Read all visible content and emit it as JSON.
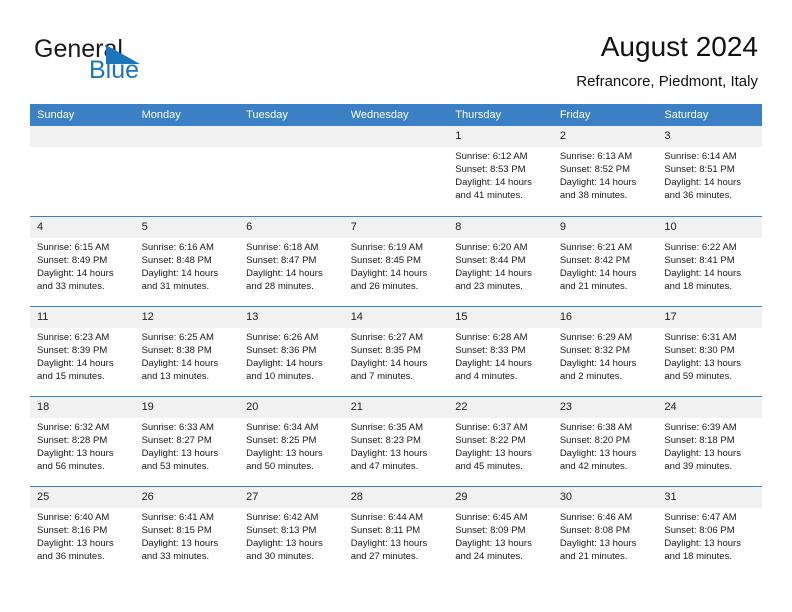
{
  "brand": {
    "name_part1": "General",
    "name_part2": "Blue",
    "logo_icon": "triangle-flag-icon",
    "accent_color": "#1b75bb"
  },
  "header": {
    "title": "August 2024",
    "subtitle": "Refrancore, Piedmont, Italy"
  },
  "theme": {
    "header_blue": "#3b7fc4",
    "daynum_background": "#f1f1f1",
    "text_color": "#1a1a1a"
  },
  "weekdays": [
    "Sunday",
    "Monday",
    "Tuesday",
    "Wednesday",
    "Thursday",
    "Friday",
    "Saturday"
  ],
  "weeks": [
    [
      {
        "day": "",
        "sunrise": "",
        "sunset": "",
        "daylight_line1": "",
        "daylight_line2": "",
        "empty": true
      },
      {
        "day": "",
        "sunrise": "",
        "sunset": "",
        "daylight_line1": "",
        "daylight_line2": "",
        "empty": true
      },
      {
        "day": "",
        "sunrise": "",
        "sunset": "",
        "daylight_line1": "",
        "daylight_line2": "",
        "empty": true
      },
      {
        "day": "",
        "sunrise": "",
        "sunset": "",
        "daylight_line1": "",
        "daylight_line2": "",
        "empty": true
      },
      {
        "day": "1",
        "sunrise": "Sunrise: 6:12 AM",
        "sunset": "Sunset: 8:53 PM",
        "daylight_line1": "Daylight: 14 hours",
        "daylight_line2": "and 41 minutes."
      },
      {
        "day": "2",
        "sunrise": "Sunrise: 6:13 AM",
        "sunset": "Sunset: 8:52 PM",
        "daylight_line1": "Daylight: 14 hours",
        "daylight_line2": "and 38 minutes."
      },
      {
        "day": "3",
        "sunrise": "Sunrise: 6:14 AM",
        "sunset": "Sunset: 8:51 PM",
        "daylight_line1": "Daylight: 14 hours",
        "daylight_line2": "and 36 minutes."
      }
    ],
    [
      {
        "day": "4",
        "sunrise": "Sunrise: 6:15 AM",
        "sunset": "Sunset: 8:49 PM",
        "daylight_line1": "Daylight: 14 hours",
        "daylight_line2": "and 33 minutes."
      },
      {
        "day": "5",
        "sunrise": "Sunrise: 6:16 AM",
        "sunset": "Sunset: 8:48 PM",
        "daylight_line1": "Daylight: 14 hours",
        "daylight_line2": "and 31 minutes."
      },
      {
        "day": "6",
        "sunrise": "Sunrise: 6:18 AM",
        "sunset": "Sunset: 8:47 PM",
        "daylight_line1": "Daylight: 14 hours",
        "daylight_line2": "and 28 minutes."
      },
      {
        "day": "7",
        "sunrise": "Sunrise: 6:19 AM",
        "sunset": "Sunset: 8:45 PM",
        "daylight_line1": "Daylight: 14 hours",
        "daylight_line2": "and 26 minutes."
      },
      {
        "day": "8",
        "sunrise": "Sunrise: 6:20 AM",
        "sunset": "Sunset: 8:44 PM",
        "daylight_line1": "Daylight: 14 hours",
        "daylight_line2": "and 23 minutes."
      },
      {
        "day": "9",
        "sunrise": "Sunrise: 6:21 AM",
        "sunset": "Sunset: 8:42 PM",
        "daylight_line1": "Daylight: 14 hours",
        "daylight_line2": "and 21 minutes."
      },
      {
        "day": "10",
        "sunrise": "Sunrise: 6:22 AM",
        "sunset": "Sunset: 8:41 PM",
        "daylight_line1": "Daylight: 14 hours",
        "daylight_line2": "and 18 minutes."
      }
    ],
    [
      {
        "day": "11",
        "sunrise": "Sunrise: 6:23 AM",
        "sunset": "Sunset: 8:39 PM",
        "daylight_line1": "Daylight: 14 hours",
        "daylight_line2": "and 15 minutes."
      },
      {
        "day": "12",
        "sunrise": "Sunrise: 6:25 AM",
        "sunset": "Sunset: 8:38 PM",
        "daylight_line1": "Daylight: 14 hours",
        "daylight_line2": "and 13 minutes."
      },
      {
        "day": "13",
        "sunrise": "Sunrise: 6:26 AM",
        "sunset": "Sunset: 8:36 PM",
        "daylight_line1": "Daylight: 14 hours",
        "daylight_line2": "and 10 minutes."
      },
      {
        "day": "14",
        "sunrise": "Sunrise: 6:27 AM",
        "sunset": "Sunset: 8:35 PM",
        "daylight_line1": "Daylight: 14 hours",
        "daylight_line2": "and 7 minutes."
      },
      {
        "day": "15",
        "sunrise": "Sunrise: 6:28 AM",
        "sunset": "Sunset: 8:33 PM",
        "daylight_line1": "Daylight: 14 hours",
        "daylight_line2": "and 4 minutes."
      },
      {
        "day": "16",
        "sunrise": "Sunrise: 6:29 AM",
        "sunset": "Sunset: 8:32 PM",
        "daylight_line1": "Daylight: 14 hours",
        "daylight_line2": "and 2 minutes."
      },
      {
        "day": "17",
        "sunrise": "Sunrise: 6:31 AM",
        "sunset": "Sunset: 8:30 PM",
        "daylight_line1": "Daylight: 13 hours",
        "daylight_line2": "and 59 minutes."
      }
    ],
    [
      {
        "day": "18",
        "sunrise": "Sunrise: 6:32 AM",
        "sunset": "Sunset: 8:28 PM",
        "daylight_line1": "Daylight: 13 hours",
        "daylight_line2": "and 56 minutes."
      },
      {
        "day": "19",
        "sunrise": "Sunrise: 6:33 AM",
        "sunset": "Sunset: 8:27 PM",
        "daylight_line1": "Daylight: 13 hours",
        "daylight_line2": "and 53 minutes."
      },
      {
        "day": "20",
        "sunrise": "Sunrise: 6:34 AM",
        "sunset": "Sunset: 8:25 PM",
        "daylight_line1": "Daylight: 13 hours",
        "daylight_line2": "and 50 minutes."
      },
      {
        "day": "21",
        "sunrise": "Sunrise: 6:35 AM",
        "sunset": "Sunset: 8:23 PM",
        "daylight_line1": "Daylight: 13 hours",
        "daylight_line2": "and 47 minutes."
      },
      {
        "day": "22",
        "sunrise": "Sunrise: 6:37 AM",
        "sunset": "Sunset: 8:22 PM",
        "daylight_line1": "Daylight: 13 hours",
        "daylight_line2": "and 45 minutes."
      },
      {
        "day": "23",
        "sunrise": "Sunrise: 6:38 AM",
        "sunset": "Sunset: 8:20 PM",
        "daylight_line1": "Daylight: 13 hours",
        "daylight_line2": "and 42 minutes."
      },
      {
        "day": "24",
        "sunrise": "Sunrise: 6:39 AM",
        "sunset": "Sunset: 8:18 PM",
        "daylight_line1": "Daylight: 13 hours",
        "daylight_line2": "and 39 minutes."
      }
    ],
    [
      {
        "day": "25",
        "sunrise": "Sunrise: 6:40 AM",
        "sunset": "Sunset: 8:16 PM",
        "daylight_line1": "Daylight: 13 hours",
        "daylight_line2": "and 36 minutes."
      },
      {
        "day": "26",
        "sunrise": "Sunrise: 6:41 AM",
        "sunset": "Sunset: 8:15 PM",
        "daylight_line1": "Daylight: 13 hours",
        "daylight_line2": "and 33 minutes."
      },
      {
        "day": "27",
        "sunrise": "Sunrise: 6:42 AM",
        "sunset": "Sunset: 8:13 PM",
        "daylight_line1": "Daylight: 13 hours",
        "daylight_line2": "and 30 minutes."
      },
      {
        "day": "28",
        "sunrise": "Sunrise: 6:44 AM",
        "sunset": "Sunset: 8:11 PM",
        "daylight_line1": "Daylight: 13 hours",
        "daylight_line2": "and 27 minutes."
      },
      {
        "day": "29",
        "sunrise": "Sunrise: 6:45 AM",
        "sunset": "Sunset: 8:09 PM",
        "daylight_line1": "Daylight: 13 hours",
        "daylight_line2": "and 24 minutes."
      },
      {
        "day": "30",
        "sunrise": "Sunrise: 6:46 AM",
        "sunset": "Sunset: 8:08 PM",
        "daylight_line1": "Daylight: 13 hours",
        "daylight_line2": "and 21 minutes."
      },
      {
        "day": "31",
        "sunrise": "Sunrise: 6:47 AM",
        "sunset": "Sunset: 8:06 PM",
        "daylight_line1": "Daylight: 13 hours",
        "daylight_line2": "and 18 minutes."
      }
    ]
  ]
}
